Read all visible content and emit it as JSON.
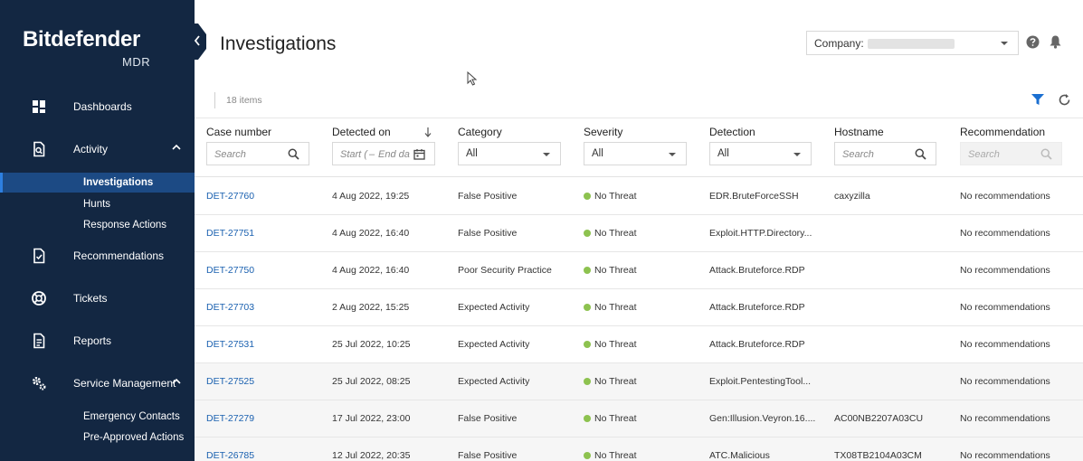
{
  "app": {
    "brand": "Bitdefender",
    "brand_sub": "MDR"
  },
  "sidebar": {
    "items": [
      {
        "label": "Dashboards",
        "icon": "grid-icon"
      },
      {
        "label": "Activity",
        "icon": "activity-doc-icon",
        "expanded": true
      },
      {
        "label": "Recommendations",
        "icon": "recommendation-doc-icon"
      },
      {
        "label": "Tickets",
        "icon": "lifebuoy-icon"
      },
      {
        "label": "Reports",
        "icon": "report-doc-icon"
      },
      {
        "label": "Service Management",
        "icon": "gears-icon",
        "expanded": true
      }
    ],
    "activity_sub": [
      "Investigations",
      "Hunts",
      "Response Actions"
    ],
    "service_sub": [
      "Emergency Contacts",
      "Pre-Approved Actions"
    ],
    "active_sub": "Investigations"
  },
  "header": {
    "title": "Investigations",
    "company_label": "Company:"
  },
  "toolbar": {
    "items_count": "18 items"
  },
  "table": {
    "columns": [
      "Case number",
      "Detected on",
      "Category",
      "Severity",
      "Detection",
      "Hostname",
      "Recommendation"
    ],
    "filters": {
      "case_placeholder": "Search",
      "date_start": "Start (",
      "date_sep": "–",
      "date_end": "End da",
      "category": "All",
      "severity": "All",
      "detection": "All",
      "hostname_placeholder": "Search",
      "recommendation_placeholder": "Search"
    },
    "rows": [
      {
        "case": "DET-27760",
        "date": "4 Aug 2022, 19:25",
        "category": "False Positive",
        "severity": "No Threat",
        "detection": "EDR.BruteForceSSH",
        "hostname": "caxyzilla",
        "recommendation": "No recommendations"
      },
      {
        "case": "DET-27751",
        "date": "4 Aug 2022, 16:40",
        "category": "False Positive",
        "severity": "No Threat",
        "detection": "Exploit.HTTP.Directory...",
        "hostname": "",
        "recommendation": "No recommendations"
      },
      {
        "case": "DET-27750",
        "date": "4 Aug 2022, 16:40",
        "category": "Poor Security Practice",
        "severity": "No Threat",
        "detection": "Attack.Bruteforce.RDP",
        "hostname": "",
        "recommendation": "No recommendations"
      },
      {
        "case": "DET-27703",
        "date": "2 Aug 2022, 15:25",
        "category": "Expected Activity",
        "severity": "No Threat",
        "detection": "Attack.Bruteforce.RDP",
        "hostname": "",
        "recommendation": "No recommendations"
      },
      {
        "case": "DET-27531",
        "date": "25 Jul 2022, 10:25",
        "category": "Expected Activity",
        "severity": "No Threat",
        "detection": "Attack.Bruteforce.RDP",
        "hostname": "",
        "recommendation": "No recommendations"
      },
      {
        "case": "DET-27525",
        "date": "25 Jul 2022, 08:25",
        "category": "Expected Activity",
        "severity": "No Threat",
        "detection": "Exploit.PentestingTool...",
        "hostname": "",
        "recommendation": "No recommendations"
      },
      {
        "case": "DET-27279",
        "date": "17 Jul 2022, 23:00",
        "category": "False Positive",
        "severity": "No Threat",
        "detection": "Gen:Illusion.Veyron.16....",
        "hostname": "AC00NB2207A03CU",
        "recommendation": "No recommendations"
      },
      {
        "case": "DET-26785",
        "date": "12 Jul 2022, 20:35",
        "category": "False Positive",
        "severity": "No Threat",
        "detection": "ATC.Malicious",
        "hostname": "TX08TB2104A03CM",
        "recommendation": "No recommendations"
      }
    ]
  },
  "colors": {
    "sidebar_bg": "#132742",
    "active_bg": "#1c4a84",
    "link": "#1b61b0",
    "no_threat": "#8dc24f",
    "filter_icon": "#1b6fd1"
  }
}
